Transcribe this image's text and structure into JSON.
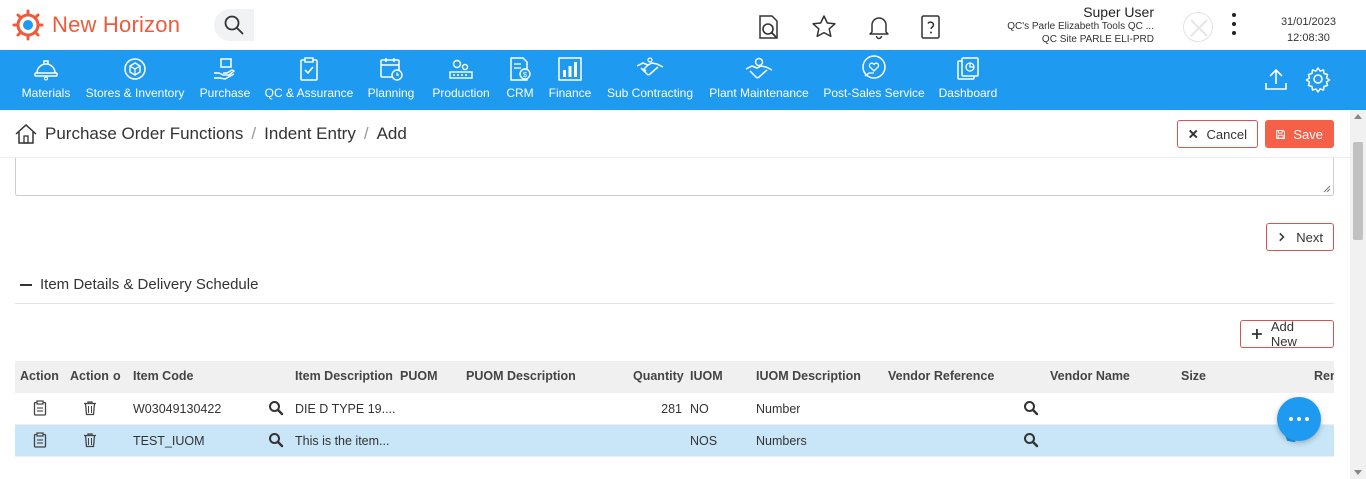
{
  "app": {
    "name": "New Horizon",
    "brand_color": "#f05a3a",
    "nav_color": "#1e9af0"
  },
  "search": {
    "placeholder": "",
    "value": ""
  },
  "user": {
    "name": "Super User",
    "company": "QC's Parle Elizabeth Tools QC ...",
    "site": "QC Site PARLE ELI-PRD"
  },
  "datetime": {
    "date": "31/01/2023",
    "time": "12:08:30"
  },
  "nav": {
    "items": [
      {
        "label": "Materials",
        "icon": "hard-hat-icon"
      },
      {
        "label": "Stores & Inventory",
        "icon": "globe-box-icon"
      },
      {
        "label": "Purchase",
        "icon": "hand-box-icon"
      },
      {
        "label": "QC & Assurance",
        "icon": "clipboard-check-icon"
      },
      {
        "label": "Planning",
        "icon": "calendar-clock-icon"
      },
      {
        "label": "Production",
        "icon": "factory-gears-icon"
      },
      {
        "label": "CRM",
        "icon": "document-user-icon"
      },
      {
        "label": "Finance",
        "icon": "bar-chart-icon"
      },
      {
        "label": "Sub Contracting",
        "icon": "handshake-icon"
      },
      {
        "label": "Plant Maintenance",
        "icon": "handshake-gear-icon"
      },
      {
        "label": "Post-Sales Service",
        "icon": "heart-hand-icon"
      },
      {
        "label": "Dashboard",
        "icon": "dashboard-icon"
      }
    ]
  },
  "breadcrumb": {
    "items": [
      "Purchase Order Functions",
      "Indent Entry",
      "Add"
    ]
  },
  "actions": {
    "cancel": "Cancel",
    "save": "Save",
    "next": "Next",
    "add_new": "Add New"
  },
  "section": {
    "title": "Item Details & Delivery Schedule"
  },
  "grid": {
    "columns": [
      "Action",
      "Action",
      "o",
      "Item Code",
      "Item Description",
      "PUOM",
      "PUOM Description",
      "Quantity",
      "IUOM",
      "IUOM Description",
      "Vendor Reference",
      "Vendor Name",
      "Size",
      "Ren"
    ],
    "rows": [
      {
        "item_code": "W03049130422",
        "item_description": "DIE D TYPE 19....",
        "puom": "",
        "puom_description": "",
        "quantity": "281",
        "iuom": "NO",
        "iuom_description": "Number",
        "vendor_reference": "",
        "vendor_name": "",
        "size": ""
      },
      {
        "item_code": "TEST_IUOM",
        "item_description": "This is the item...",
        "puom": "",
        "puom_description": "",
        "quantity": "",
        "iuom": "NOS",
        "iuom_description": "Numbers",
        "vendor_reference": "",
        "vendor_name": "",
        "size": ""
      }
    ]
  }
}
